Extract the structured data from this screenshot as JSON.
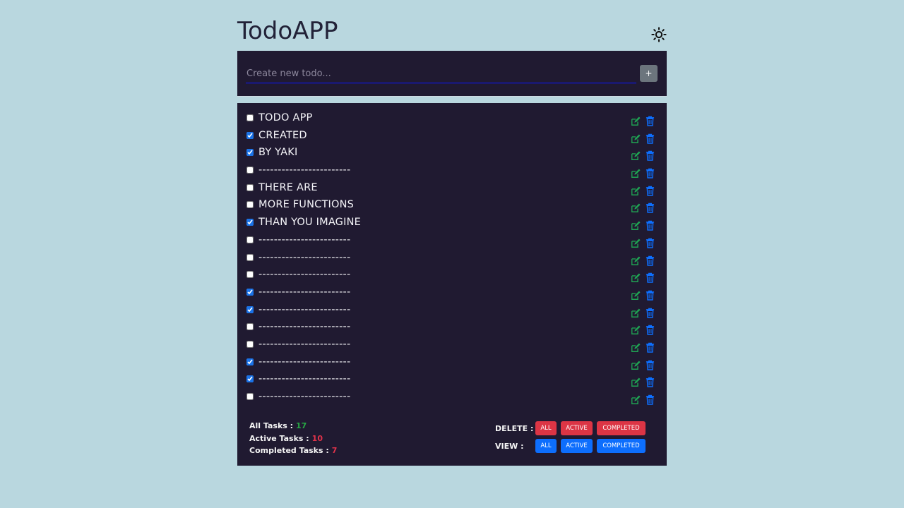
{
  "app": {
    "title": "TodoAPP",
    "theme_toggle_icon": "sun-icon"
  },
  "input": {
    "placeholder": "Create new todo...",
    "value": "",
    "add_label": "+"
  },
  "todos": [
    {
      "text": "TODO APP",
      "checked": false
    },
    {
      "text": "CREATED",
      "checked": true
    },
    {
      "text": "BY YAKI",
      "checked": true
    },
    {
      "text": "------------------------",
      "checked": false
    },
    {
      "text": "THERE ARE",
      "checked": false
    },
    {
      "text": "MORE FUNCTIONS",
      "checked": false
    },
    {
      "text": "THAN YOU IMAGINE",
      "checked": true
    },
    {
      "text": "------------------------",
      "checked": false
    },
    {
      "text": "------------------------",
      "checked": false
    },
    {
      "text": "------------------------",
      "checked": false
    },
    {
      "text": "------------------------",
      "checked": true
    },
    {
      "text": "------------------------",
      "checked": true
    },
    {
      "text": "------------------------",
      "checked": false
    },
    {
      "text": "------------------------",
      "checked": false
    },
    {
      "text": "------------------------",
      "checked": true
    },
    {
      "text": "------------------------",
      "checked": true
    },
    {
      "text": "------------------------",
      "checked": false
    }
  ],
  "stats": {
    "all_label": "All Tasks :",
    "all_value": "17",
    "active_label": "Active Tasks :",
    "active_value": "10",
    "completed_label": "Completed Tasks :",
    "completed_value": "7"
  },
  "controls": {
    "delete_label": "DELETE :",
    "view_label": "VIEW :",
    "all": "ALL",
    "active": "ACTIVE",
    "completed": "COMPLETED"
  },
  "icons": {
    "edit": "edit-icon",
    "delete": "trash-icon"
  },
  "colors": {
    "background": "#b9d7df",
    "panel": "#201a31",
    "edit_icon": "#1fa353",
    "delete_icon": "#0d6efd",
    "all_value": "#27a844",
    "active_completed_value": "#e0334a",
    "danger": "#dc3545",
    "primary": "#0d6efd"
  }
}
